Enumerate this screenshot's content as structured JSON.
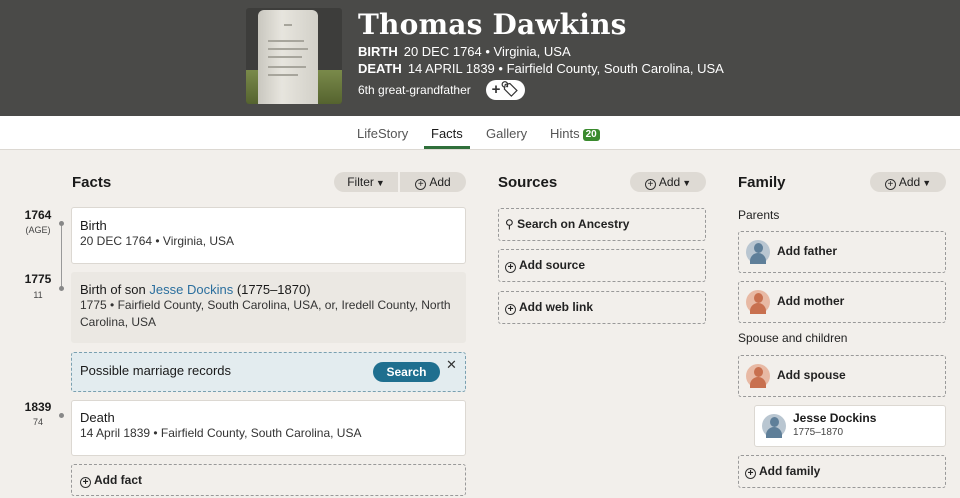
{
  "profile": {
    "name": "Thomas Dawkins",
    "birth_label": "BIRTH",
    "birth_value": "20 DEC 1764 • Virginia, USA",
    "death_label": "DEATH",
    "death_value": "14 APRIL 1839 • Fairfield County, South Carolina, USA",
    "relationship": "6th great-grandfather",
    "tag_button": "+🏷"
  },
  "tabs": [
    {
      "label": "LifeStory"
    },
    {
      "label": "Facts"
    },
    {
      "label": "Gallery"
    },
    {
      "label": "Hints",
      "badge": "20"
    }
  ],
  "facts": {
    "title": "Facts",
    "filter_label": "Filter",
    "add_label": "Add",
    "items": [
      {
        "year": "1764",
        "age": "(AGE)",
        "title": "Birth",
        "detail": "20 DEC 1764 • Virginia, USA"
      },
      {
        "year": "1775",
        "age": "11",
        "title_prefix": "Birth of son",
        "title_link": "Jesse Dockins",
        "title_suffix": "(1775–1870)",
        "detail": "1775 • Fairfield County, South Carolina, USA, or, Iredell County, North Carolina, USA"
      },
      {
        "year": "1839",
        "age": "74",
        "title": "Death",
        "detail": "14 April 1839 • Fairfield County, South Carolina, USA"
      }
    ],
    "promo_text": "Possible marriage records",
    "promo_button": "Search",
    "promo_close": "✕",
    "add_fact": "Add fact"
  },
  "sources": {
    "title": "Sources",
    "add_label": "Add",
    "search": "Search on Ancestry",
    "add_source": "Add source",
    "add_web_link": "Add web link"
  },
  "family": {
    "title": "Family",
    "add_label": "Add",
    "parents_heading": "Parents",
    "add_father": "Add father",
    "add_mother": "Add mother",
    "spouse_heading": "Spouse and children",
    "add_spouse": "Add spouse",
    "child_name": "Jesse Dockins",
    "child_years": "1775–1870",
    "add_family": "Add family"
  },
  "colors": {
    "header_bg": "#4a4a48",
    "accent_green": "#2f6f3a",
    "link_blue": "#2b6f9e",
    "search_button": "#1f6f8f",
    "male_avatar": "#5f7f99",
    "female_avatar": "#c8704f"
  }
}
